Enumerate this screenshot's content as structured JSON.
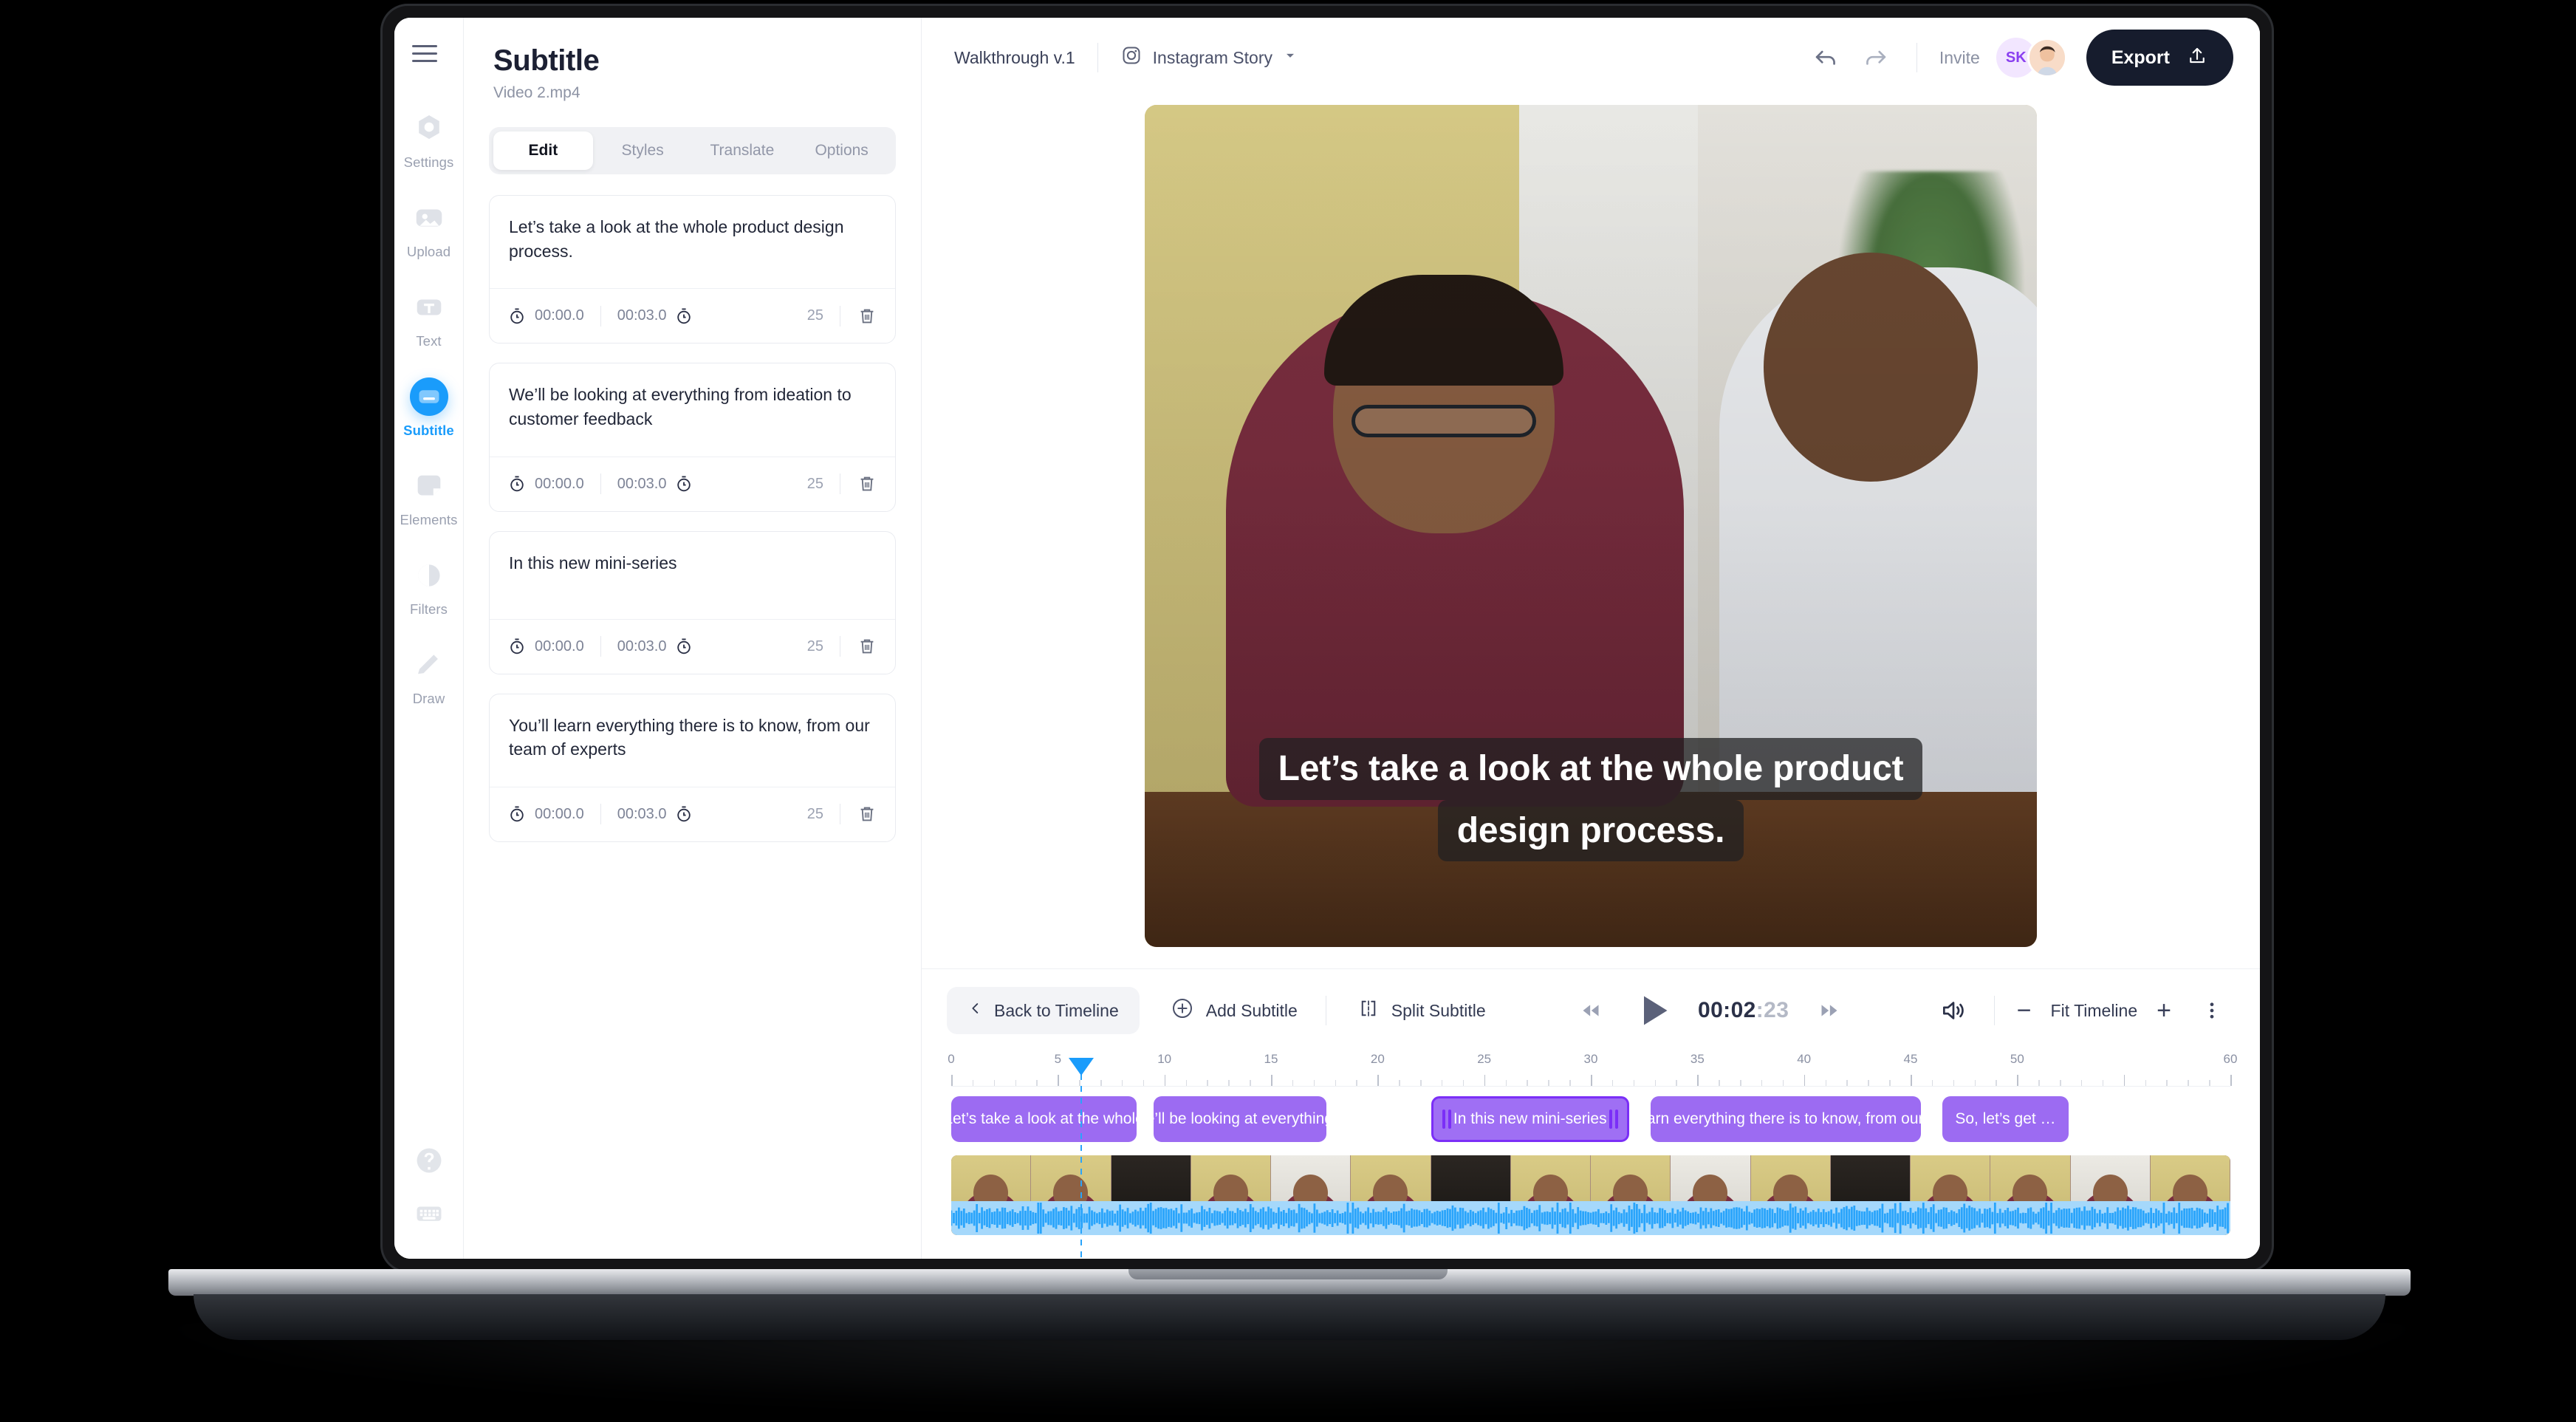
{
  "rail": {
    "menu_icon": "hamburger-icon",
    "items": [
      {
        "label": "Settings",
        "icon": "settings-icon",
        "active": false
      },
      {
        "label": "Upload",
        "icon": "upload-icon",
        "active": false
      },
      {
        "label": "Text",
        "icon": "text-icon",
        "active": false
      },
      {
        "label": "Subtitle",
        "icon": "subtitle-icon",
        "active": true
      },
      {
        "label": "Elements",
        "icon": "elements-icon",
        "active": false
      },
      {
        "label": "Filters",
        "icon": "filters-icon",
        "active": false
      },
      {
        "label": "Draw",
        "icon": "draw-icon",
        "active": false
      }
    ],
    "bottom": [
      {
        "icon": "help-icon"
      },
      {
        "icon": "keyboard-icon"
      }
    ]
  },
  "panel": {
    "title": "Subtitle",
    "filename": "Video 2.mp4",
    "tabs": [
      {
        "label": "Edit",
        "active": true
      },
      {
        "label": "Styles",
        "active": false
      },
      {
        "label": "Translate",
        "active": false
      },
      {
        "label": "Options",
        "active": false
      }
    ],
    "cards": [
      {
        "text": "Let’s take a look at the whole product design process.",
        "start": "00:00.0",
        "end": "00:03.0",
        "count": "25"
      },
      {
        "text": "We’ll be looking at everything from ideation to customer feedback",
        "start": "00:00.0",
        "end": "00:03.0",
        "count": "25"
      },
      {
        "text": "In this new mini-series",
        "start": "00:00.0",
        "end": "00:03.0",
        "count": "25"
      },
      {
        "text": "You’ll learn everything there is to know, from our team of experts",
        "start": "00:00.0",
        "end": "00:03.0",
        "count": "25"
      }
    ]
  },
  "topbar": {
    "project_name": "Walkthrough v.1",
    "format_label": "Instagram Story",
    "format_icon": "instagram-icon",
    "chevron_icon": "chevron-down-icon",
    "undo_icon": "undo-icon",
    "redo_icon": "redo-icon",
    "invite_label": "Invite",
    "avatar_initials": "SK",
    "export_label": "Export",
    "export_icon": "share-upload-icon"
  },
  "preview": {
    "caption_line_1": "Let’s take a look at the whole product",
    "caption_line_2": "design process."
  },
  "toolbar": {
    "back_label": "Back to Timeline",
    "back_icon": "chevron-left-icon",
    "add_label": "Add Subtitle",
    "add_icon": "plus-circle-icon",
    "split_label": "Split Subtitle",
    "split_icon": "split-icon",
    "rewind_icon": "rewind-icon",
    "play_icon": "play-icon",
    "forward_icon": "fast-forward-icon",
    "time_main": "00:02",
    "time_frames": ":23",
    "volume_icon": "volume-icon",
    "zoom_out_icon": "minus-icon",
    "zoom_label": "Fit Timeline",
    "zoom_in_icon": "plus-icon",
    "more_icon": "more-vertical-icon"
  },
  "timeline": {
    "ruler_labels": [
      "0",
      "5",
      "10",
      "15",
      "20",
      "25",
      "30",
      "35",
      "40",
      "45",
      "50",
      "60"
    ],
    "ruler_max": 60,
    "playhead_seconds": 6.1,
    "clips": [
      {
        "label": "Let’s take a look at the whole",
        "start": 0.0,
        "end": 8.7,
        "selected": false
      },
      {
        "label": "We’ll be looking at everything…",
        "start": 9.5,
        "end": 17.6,
        "selected": false
      },
      {
        "label": "In this new mini-series",
        "start": 22.5,
        "end": 31.8,
        "selected": true
      },
      {
        "label": "You’ll learn everything there is to know, from our team…",
        "start": 32.8,
        "end": 45.5,
        "selected": false
      },
      {
        "label": "So, let’s get …",
        "start": 46.5,
        "end": 52.4,
        "selected": false
      }
    ]
  },
  "colors": {
    "accent_blue": "#1a9cfb",
    "clip_purple": "#9c6bf2",
    "clip_selected_border": "#7b2ff7",
    "export_dark": "#161c2d",
    "waveform": "#29a4fb"
  }
}
